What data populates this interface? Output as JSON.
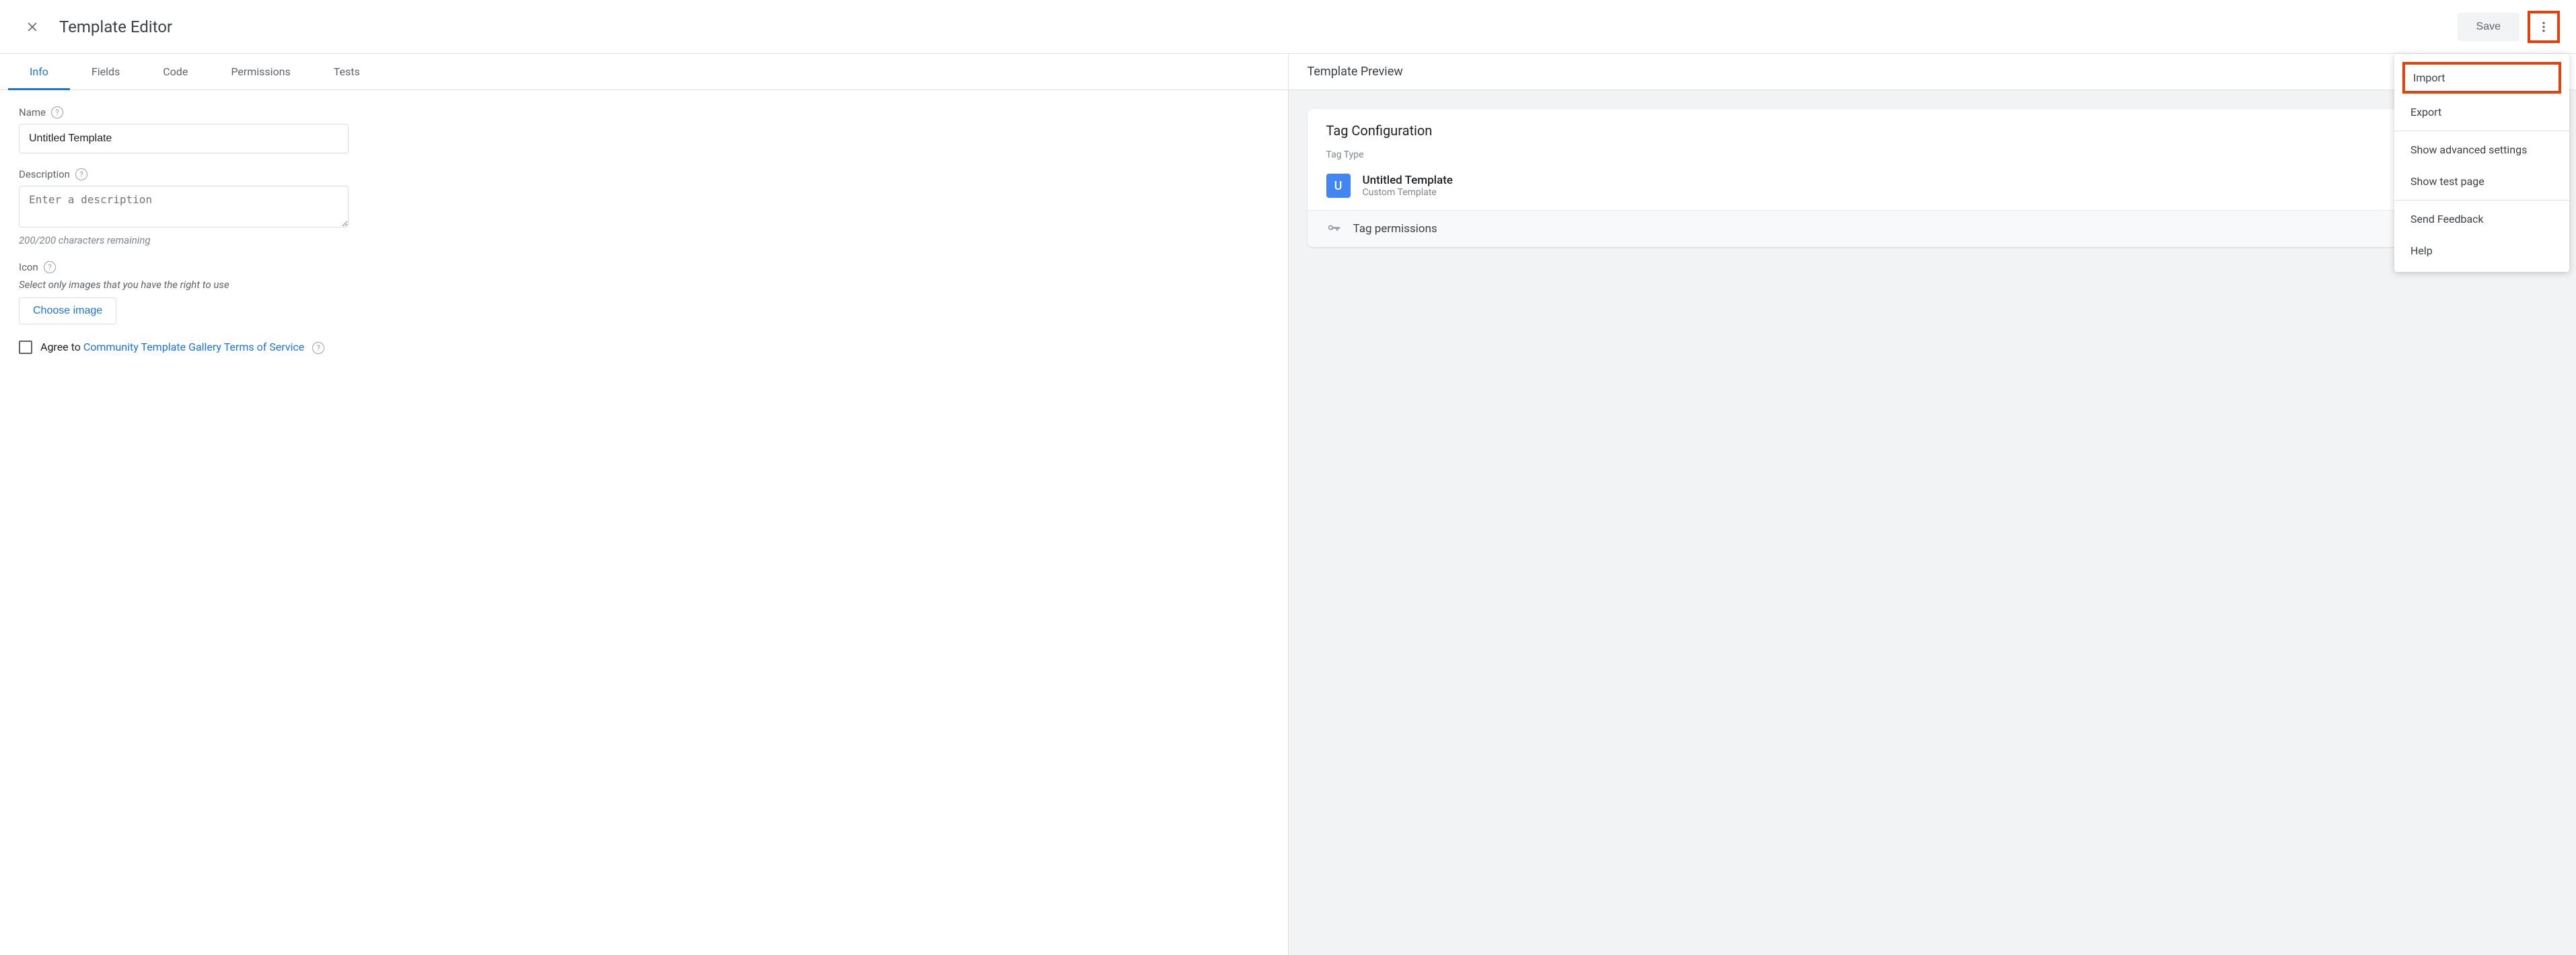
{
  "header": {
    "title": "Template Editor",
    "save_label": "Save"
  },
  "tabs": [
    "Info",
    "Fields",
    "Code",
    "Permissions",
    "Tests"
  ],
  "active_tab_index": 0,
  "info_form": {
    "name_label": "Name",
    "name_value": "Untitled Template",
    "description_label": "Description",
    "description_placeholder": "Enter a description",
    "description_value": "",
    "char_remaining": "200/200 characters remaining",
    "icon_label": "Icon",
    "icon_hint": "Select only images that you have the right to use",
    "choose_image_label": "Choose image",
    "agree_prefix": "Agree to ",
    "agree_link": "Community Template Gallery Terms of Service"
  },
  "preview": {
    "title": "Template Preview",
    "card_title": "Tag Configuration",
    "tag_type_label": "Tag Type",
    "tag_icon_letter": "U",
    "tag_name": "Untitled Template",
    "tag_sub": "Custom Template",
    "permissions_label": "Tag permissions"
  },
  "menu": {
    "import": "Import",
    "export": "Export",
    "advanced": "Show advanced settings",
    "testpage": "Show test page",
    "feedback": "Send Feedback",
    "help": "Help"
  }
}
